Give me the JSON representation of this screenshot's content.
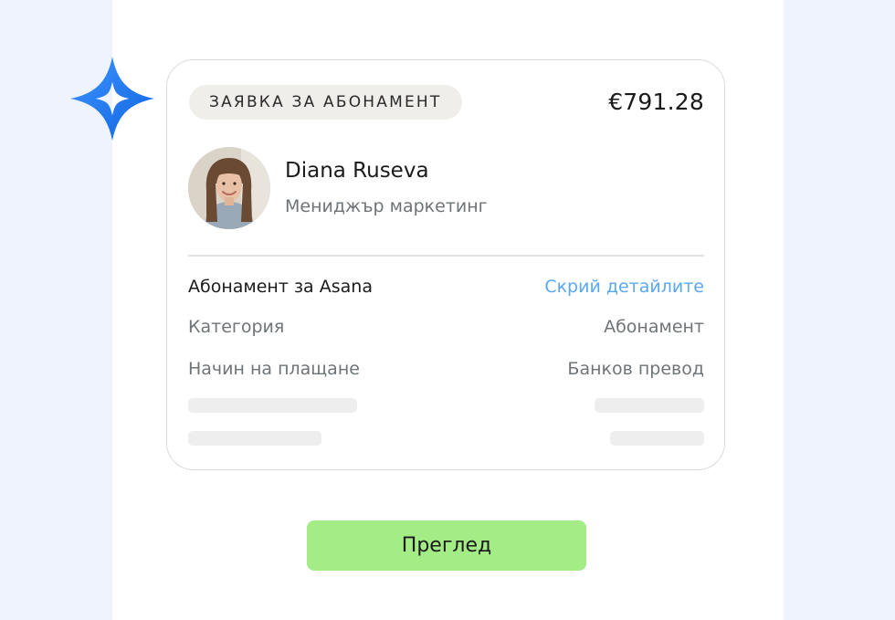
{
  "card": {
    "badge": "ЗАЯВКА ЗА АБОНАМЕНТ",
    "amount": "€791.28",
    "user": {
      "name": "Diana Ruseva",
      "role": "Мениджър маркетинг"
    },
    "details": {
      "title": "Абонамент за Asana",
      "toggle_label": "Скрий детайлите",
      "rows": [
        {
          "label": "Категория",
          "value": "Абонамент"
        },
        {
          "label": "Начин на плащане",
          "value": "Банков превод"
        }
      ]
    }
  },
  "actions": {
    "review_label": "Преглед"
  },
  "colors": {
    "background": "#eef3fd",
    "accent_blue": "#1f7bf0",
    "link": "#5aa8f2",
    "button": "#a3ec86"
  },
  "icons": {
    "logo": "sparkle-icon",
    "avatar": "user-photo"
  }
}
